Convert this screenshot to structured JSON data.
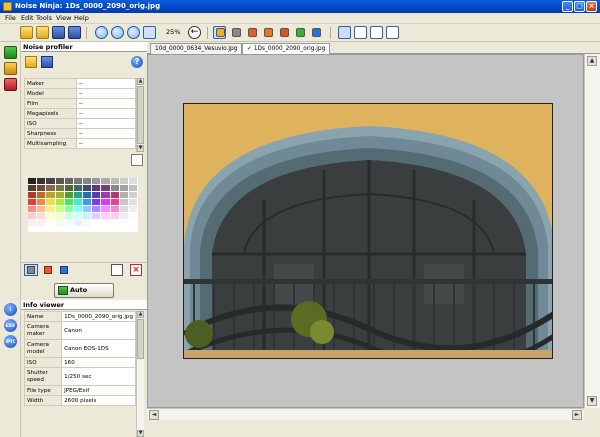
{
  "window": {
    "title": "Noise Ninja: 1Ds_0000_2090_orig.jpg",
    "buttons": [
      "_",
      "□",
      "×"
    ]
  },
  "menu": [
    "File",
    "Edit",
    "Tools",
    "View",
    "Help"
  ],
  "toolbar": {
    "zoom_level": "25%"
  },
  "noise_profiler": {
    "title": "Noise profiler",
    "rows": [
      {
        "key": "Maker",
        "value": "--"
      },
      {
        "key": "Model",
        "value": "--"
      },
      {
        "key": "Film",
        "value": "--"
      },
      {
        "key": "Megapixels",
        "value": "--"
      },
      {
        "key": "ISO",
        "value": "--"
      },
      {
        "key": "Sharpness",
        "value": "--"
      },
      {
        "key": "Multisampling",
        "value": "--"
      }
    ],
    "auto_profile_label": "Auto profile"
  },
  "info_viewer": {
    "title": "Info viewer",
    "rows": [
      {
        "key": "Name",
        "value": "1Ds_0000_2090_orig.jpg"
      },
      {
        "key": "Camera maker",
        "value": "Canon"
      },
      {
        "key": "Camera model",
        "value": "Canon EOS-1DS"
      },
      {
        "key": "ISO",
        "value": "160"
      },
      {
        "key": "Shutter speed",
        "value": "1/250 sec"
      },
      {
        "key": "File type",
        "value": "JPEG/Exif"
      },
      {
        "key": "Width",
        "value": "2600 pixels"
      }
    ]
  },
  "tabs": [
    {
      "label": "10d_0000_0634_Vesuvio.jpg",
      "active": false
    },
    {
      "label": "1Ds_0000_2090_orig.jpg",
      "active": true
    }
  ],
  "left_strip": {
    "exif_label": "EXIF",
    "iptc_label": "IPTC"
  },
  "colors": {
    "wall": "#e2b865",
    "arch_stone": "#6f8a96",
    "glass": "#3b3e3e",
    "accent_blue": "#0347c6"
  }
}
